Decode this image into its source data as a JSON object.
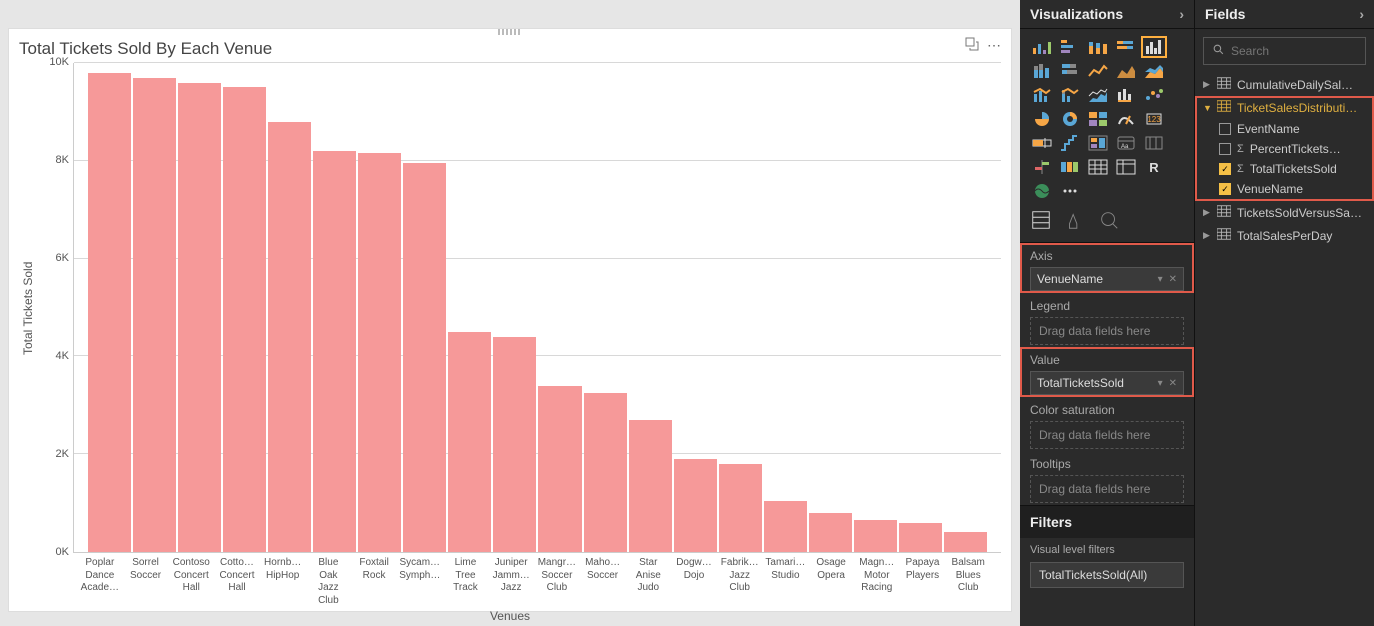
{
  "chart_data": {
    "type": "bar",
    "title": "Total Tickets Sold By Each Venue",
    "xlabel": "Venues",
    "ylabel": "Total Tickets Sold",
    "ylim": [
      0,
      10000
    ],
    "yticks": [
      "10K",
      "8K",
      "6K",
      "4K",
      "2K",
      "0K"
    ],
    "categories": [
      "Poplar Dance Acade…",
      "Sorrel Soccer",
      "Contoso Concert Hall",
      "Cotto… Concert Hall",
      "Hornb… HipHop",
      "Blue Oak Jazz Club",
      "Foxtail Rock",
      "Sycam… Symph…",
      "Lime Tree Track",
      "Juniper Jamm… Jazz",
      "Mangr… Soccer Club",
      "Maho… Soccer",
      "Star Anise Judo",
      "Dogw… Dojo",
      "Fabrik… Jazz Club",
      "Tamari… Studio",
      "Osage Opera",
      "Magn… Motor Racing",
      "Papaya Players",
      "Balsam Blues Club"
    ],
    "values": [
      9800,
      9700,
      9600,
      9500,
      8800,
      8200,
      8150,
      7950,
      4500,
      4400,
      3400,
      3250,
      2700,
      1900,
      1800,
      1050,
      800,
      650,
      600,
      400
    ]
  },
  "viz_panel": {
    "title": "Visualizations",
    "wells": {
      "axis_label": "Axis",
      "axis_value": "VenueName",
      "legend_label": "Legend",
      "legend_placeholder": "Drag data fields here",
      "value_label": "Value",
      "value_value": "TotalTicketsSold",
      "colorsat_label": "Color saturation",
      "colorsat_placeholder": "Drag data fields here",
      "tooltips_label": "Tooltips",
      "tooltips_placeholder": "Drag data fields here"
    },
    "filters_title": "Filters",
    "filters_sub": "Visual level filters",
    "filter_chip": "TotalTicketsSold(All)"
  },
  "fields_panel": {
    "title": "Fields",
    "search_placeholder": "Search",
    "tables": {
      "t1": "CumulativeDailySal…",
      "t2": "TicketSalesDistributi…",
      "t2_fields": {
        "f1": "EventName",
        "f2": "PercentTickets…",
        "f3": "TotalTicketsSold",
        "f4": "VenueName"
      },
      "t3": "TicketsSoldVersusSa…",
      "t4": "TotalSalesPerDay"
    }
  }
}
